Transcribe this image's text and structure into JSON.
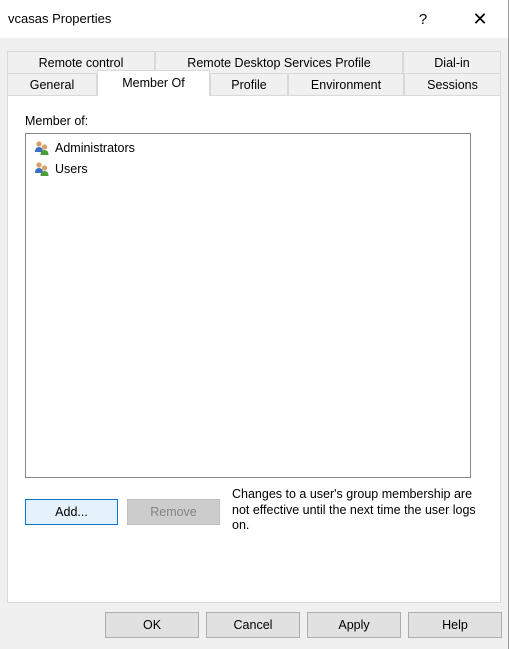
{
  "window": {
    "title": "vcasas Properties",
    "help_label": "?",
    "close_label": "✕"
  },
  "tabs_row1": [
    {
      "label": "Remote control"
    },
    {
      "label": "Remote Desktop Services Profile"
    },
    {
      "label": "Dial-in"
    }
  ],
  "tabs_row2": [
    {
      "label": "General"
    },
    {
      "label": "Member Of",
      "active": true
    },
    {
      "label": "Profile"
    },
    {
      "label": "Environment"
    },
    {
      "label": "Sessions"
    }
  ],
  "member_of": {
    "label": "Member of:",
    "items": [
      {
        "name": "Administrators",
        "icon": "group-icon"
      },
      {
        "name": "Users",
        "icon": "group-icon"
      }
    ]
  },
  "actions": {
    "add_label": "Add...",
    "remove_label": "Remove",
    "note": "Changes to a user's group membership are not effective until the next time the user logs on."
  },
  "footer": {
    "ok_label": "OK",
    "cancel_label": "Cancel",
    "apply_label": "Apply",
    "help_label": "Help"
  }
}
